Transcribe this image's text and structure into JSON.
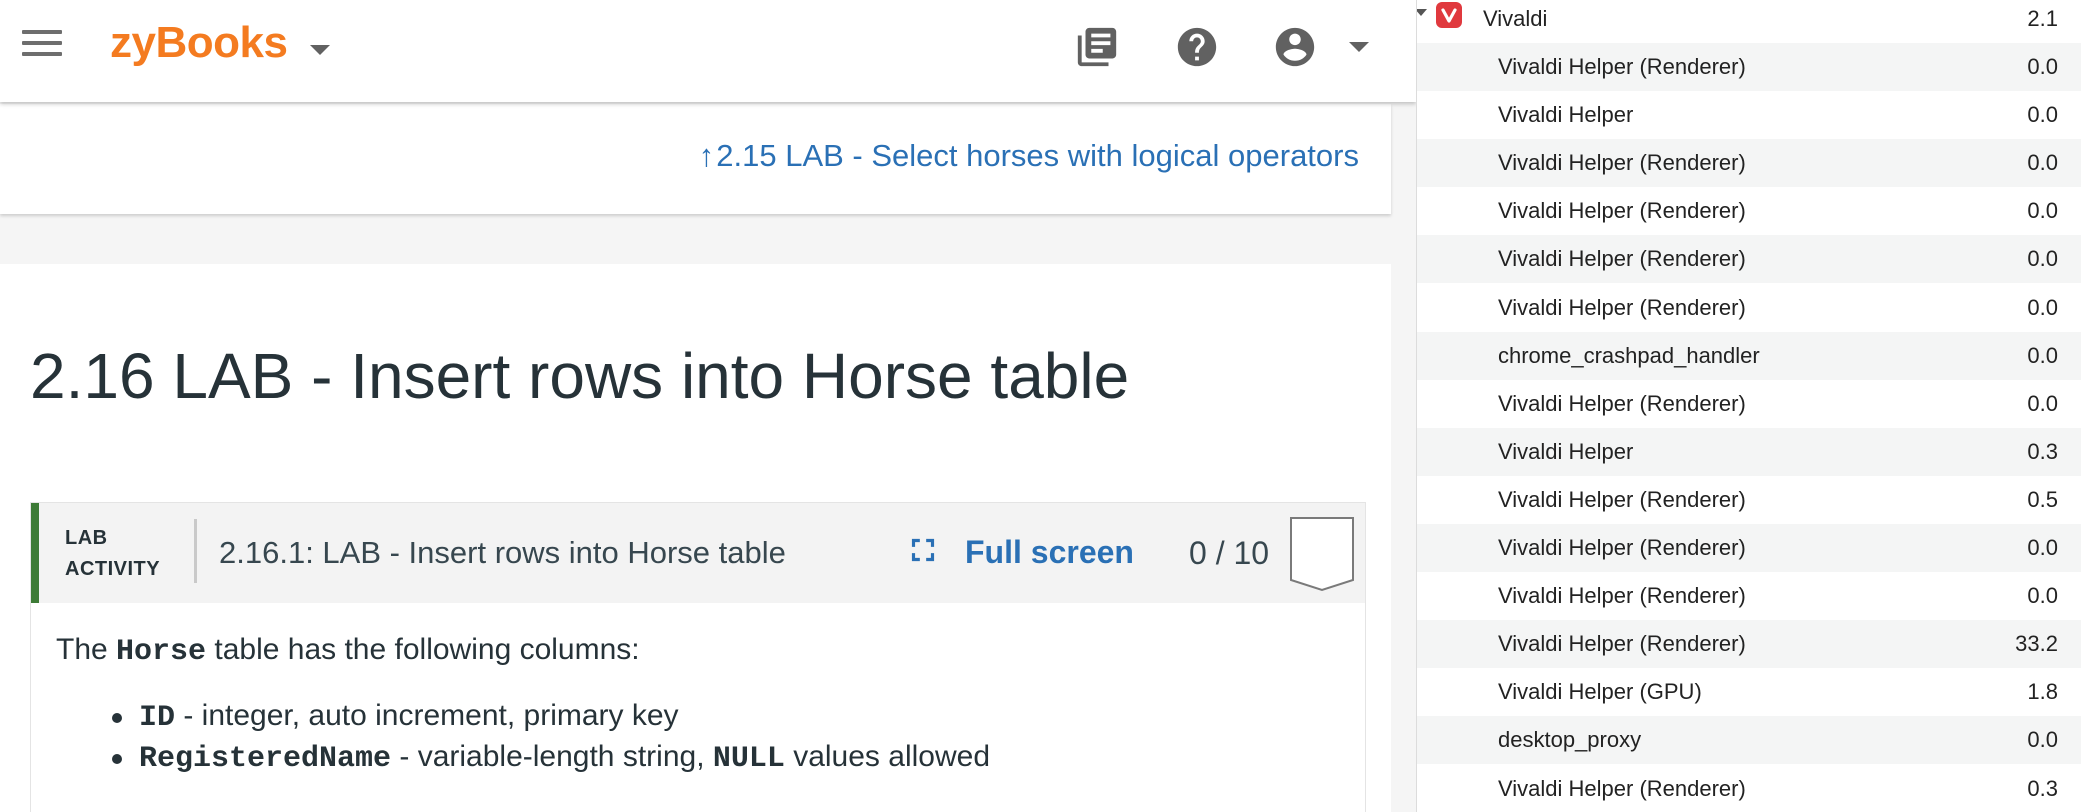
{
  "topbar": {
    "logo": "zyBooks",
    "icons": [
      "menu-icon",
      "library-icon",
      "help-icon",
      "account-icon"
    ]
  },
  "prev_section": {
    "arrow": "↑",
    "link": "2.15 LAB - Select horses with logical operators"
  },
  "section": {
    "title": "2.16 LAB - Insert rows into Horse table"
  },
  "activity": {
    "type_line1": "LAB",
    "type_line2": "ACTIVITY",
    "title": "2.16.1: LAB - Insert rows into Horse table",
    "fullscreen_label": "Full screen",
    "score": "0 / 10",
    "intro_before": "The ",
    "intro_code": "Horse",
    "intro_after": " table has the following columns:",
    "columns": [
      {
        "name": "ID",
        "desc": " - integer, auto increment, primary key"
      },
      {
        "name": "RegisteredName",
        "desc": " - variable-length string, ",
        "code2": "NULL",
        "desc2": " values allowed"
      }
    ]
  },
  "activity_monitor": {
    "colors": {
      "row_alt": "#f4f5f5",
      "vivaldi_icon": "#e0393e"
    },
    "parent": {
      "name": "Vivaldi",
      "cpu": "2.1",
      "icon": "vivaldi-icon"
    },
    "rows": [
      {
        "name": "Vivaldi Helper (Renderer)",
        "cpu": "0.0"
      },
      {
        "name": "Vivaldi Helper",
        "cpu": "0.0"
      },
      {
        "name": "Vivaldi Helper (Renderer)",
        "cpu": "0.0"
      },
      {
        "name": "Vivaldi Helper (Renderer)",
        "cpu": "0.0"
      },
      {
        "name": "Vivaldi Helper (Renderer)",
        "cpu": "0.0"
      },
      {
        "name": "Vivaldi Helper (Renderer)",
        "cpu": "0.0"
      },
      {
        "name": "chrome_crashpad_handler",
        "cpu": "0.0"
      },
      {
        "name": "Vivaldi Helper (Renderer)",
        "cpu": "0.0"
      },
      {
        "name": "Vivaldi Helper",
        "cpu": "0.3"
      },
      {
        "name": "Vivaldi Helper (Renderer)",
        "cpu": "0.5"
      },
      {
        "name": "Vivaldi Helper (Renderer)",
        "cpu": "0.0"
      },
      {
        "name": "Vivaldi Helper (Renderer)",
        "cpu": "0.0"
      },
      {
        "name": "Vivaldi Helper (Renderer)",
        "cpu": "33.2"
      },
      {
        "name": "Vivaldi Helper (GPU)",
        "cpu": "1.8"
      },
      {
        "name": "desktop_proxy",
        "cpu": "0.0"
      },
      {
        "name": "Vivaldi Helper (Renderer)",
        "cpu": "0.3"
      }
    ]
  }
}
